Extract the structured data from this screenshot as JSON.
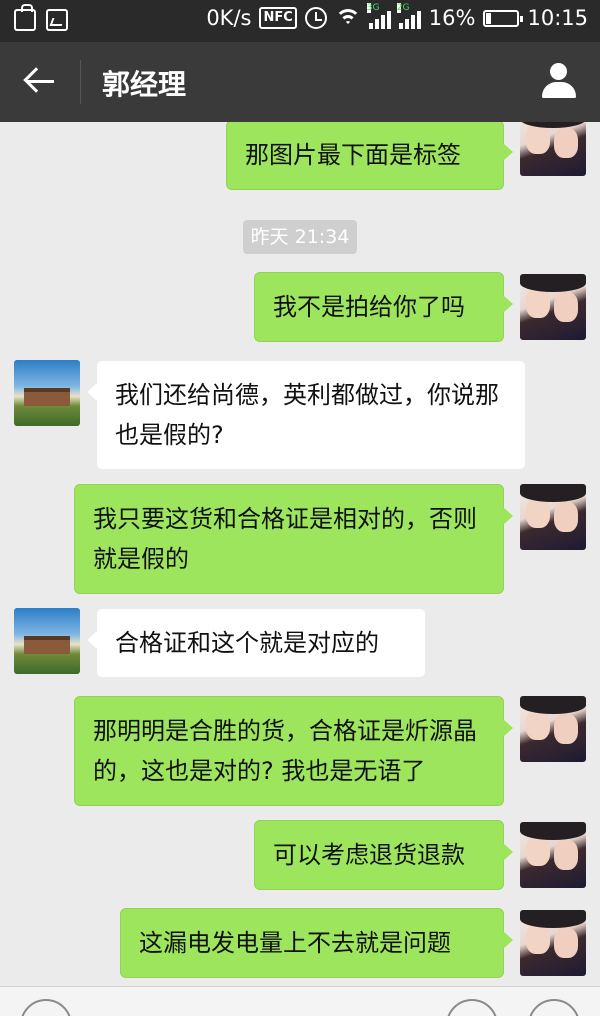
{
  "status_bar": {
    "speed": "0K/s",
    "nfc": "NFC",
    "net_type_1": "3G",
    "net_type_2": "2G",
    "battery": "16%",
    "time": "10:15"
  },
  "header": {
    "title": "郭经理"
  },
  "chat": {
    "timestamp": "昨天 21:34",
    "messages": [
      {
        "from": "me",
        "text": "那图片最下面是标签"
      },
      {
        "from": "me",
        "text": "我不是拍给你了吗"
      },
      {
        "from": "them",
        "text": "我们还给尚德，英利都做过，你说那也是假的?"
      },
      {
        "from": "me",
        "text": "我只要这货和合格证是相对的，否则就是假的"
      },
      {
        "from": "them",
        "text": "合格证和这个就是对应的"
      },
      {
        "from": "me",
        "text": "那明明是合胜的货，合格证是炘源晶的，这也是对的? 我也是无语了"
      },
      {
        "from": "me",
        "text": "可以考虑退货退款"
      },
      {
        "from": "me",
        "text": "这漏电发电量上不去就是问题"
      }
    ]
  },
  "icons": {
    "back": "back-arrow-icon",
    "profile": "person-icon"
  },
  "colors": {
    "my_bubble": "#9ee55e",
    "their_bubble": "#ffffff",
    "chat_background": "#ebebeb",
    "title_bar": "#3a3a3a"
  }
}
